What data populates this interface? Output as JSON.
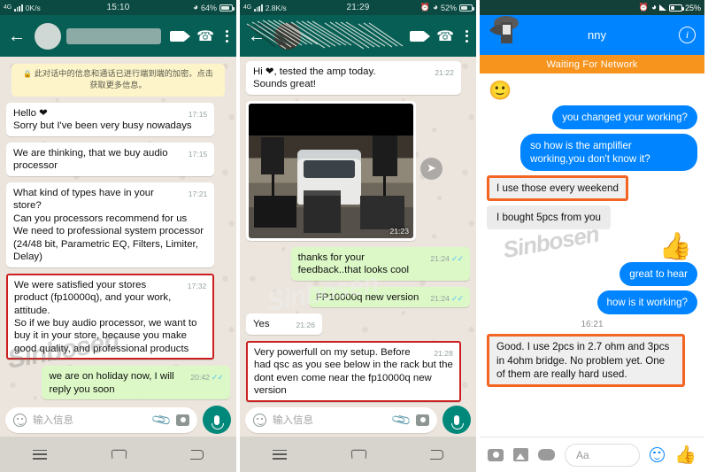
{
  "panel1": {
    "status": {
      "network": "4G",
      "speed": "0K/s",
      "time": "15:10",
      "battery": "64%"
    },
    "header": {
      "back_icon": "arrow-left-icon",
      "contact_name_redacted": "",
      "video_icon": "video-call-icon",
      "call_icon": "phone-call-icon",
      "menu_icon": "overflow-menu-icon"
    },
    "encryption_notice": "此对话中的信息和通话已进行端到端的加密。点击获取更多信息。",
    "messages": [
      {
        "side": "in",
        "text": "Hello ❤\nSorry but I've been very busy nowadays",
        "time": "17:15",
        "highlight": false
      },
      {
        "side": "in",
        "text": "We are thinking, that we buy audio processor",
        "time": "17:15",
        "highlight": false
      },
      {
        "side": "in",
        "text": "What kind of types have in your store?\nCan you processors recommend for us\nWe need to professional system processor (24/48 bit, Parametric EQ, Filters, Limiter, Delay)",
        "time": "17:21",
        "highlight": false
      },
      {
        "side": "in",
        "text": "We were satisfied your stores product (fp10000q), and your work, attitude.\nSo if we buy audio processor, we want to buy it in your store, because you make good quality, and professional products",
        "time": "17:32",
        "highlight": true
      },
      {
        "side": "out",
        "text": "we are on holiday now, I will reply you soon",
        "time": "20:42",
        "highlight": false,
        "ticks": "✓✓"
      }
    ],
    "input": {
      "placeholder": "输入信息",
      "emoji_icon": "emoji-icon",
      "attach_icon": "paperclip-icon",
      "camera_icon": "camera-icon",
      "mic_icon": "microphone-icon"
    },
    "navbar": {
      "menu_icon": "recents-icon",
      "home_icon": "home-icon",
      "back_icon": "back-icon"
    }
  },
  "panel2": {
    "status": {
      "network": "4G",
      "speed": "2.8K/s",
      "time": "21:29",
      "alarm_icon": "alarm-icon",
      "battery": "52%"
    },
    "header": {
      "back_icon": "arrow-left-icon",
      "contact_name_redacted": "",
      "video_icon": "video-call-icon",
      "call_icon": "phone-call-icon",
      "menu_icon": "overflow-menu-icon"
    },
    "messages": [
      {
        "side": "in",
        "type": "text",
        "text": "Hi ❤, tested the amp today.\nSounds great!",
        "time": "21:22",
        "highlight": false
      },
      {
        "side": "in",
        "type": "image",
        "caption": "photo of garage with white van, two PA speakers on stands, subwoofers and an amplifier rack",
        "time": "21:23",
        "forward_icon": "forward-icon"
      },
      {
        "side": "out",
        "type": "text",
        "text": "thanks for your feedback..that looks cool",
        "time": "21:24",
        "ticks": "✓✓",
        "highlight": false
      },
      {
        "side": "out",
        "type": "text",
        "text": "FP10000q new version",
        "time": "21:24",
        "ticks": "✓✓",
        "highlight": false
      },
      {
        "side": "in",
        "type": "text",
        "text": "Yes",
        "time": "21:26",
        "highlight": false
      },
      {
        "side": "in",
        "type": "text",
        "text": "Very powerfull on my setup. Before had qsc as you see below in the rack but the dont even come near the fp10000q new version",
        "time": "21:28",
        "highlight": true
      }
    ],
    "input": {
      "placeholder": "输入信息",
      "emoji_icon": "emoji-icon",
      "attach_icon": "paperclip-icon",
      "camera_icon": "camera-icon",
      "mic_icon": "microphone-icon"
    },
    "navbar": {
      "menu_icon": "recents-icon",
      "home_icon": "home-icon",
      "back_icon": "back-icon"
    }
  },
  "panel3": {
    "status": {
      "alarm_icon": "alarm-icon",
      "wifi_icon": "wifi-icon",
      "signal_icon": "signal-icon",
      "battery": "25%"
    },
    "header": {
      "contact_name": "nny",
      "info_icon": "info-icon",
      "avatar_masked": true
    },
    "banner": "Waiting For Network",
    "messages": [
      {
        "side": "them",
        "type": "emoji",
        "text": "🙂"
      },
      {
        "side": "me",
        "type": "text",
        "text": "you changed your working?"
      },
      {
        "side": "me",
        "type": "text",
        "text": "so how is the amplifier working,you don't know it?"
      },
      {
        "side": "them",
        "type": "text",
        "text": "I use those every weekend",
        "highlight": true
      },
      {
        "side": "them",
        "type": "text",
        "text": "I bought 5pcs from you"
      },
      {
        "side": "me",
        "type": "thumb",
        "text": "👍"
      },
      {
        "side": "me",
        "type": "text",
        "text": "great to hear"
      },
      {
        "side": "me",
        "type": "text",
        "text": "how is it working?"
      },
      {
        "side": "divider",
        "type": "time",
        "text": "16:21"
      },
      {
        "side": "them",
        "type": "text",
        "text": "Good. I use 2pcs in 2.7 ohm and 3pcs in 4ohm bridge. No problem yet. One of them are really hard used.",
        "highlight": true
      }
    ],
    "input": {
      "placeholder": "Aa",
      "camera_icon": "camera-icon",
      "gallery_icon": "gallery-icon",
      "games_icon": "games-icon",
      "emoji_icon": "emoji-icon",
      "like_icon": "thumbs-up-icon"
    }
  },
  "watermark": "Sinbosen",
  "colors": {
    "whatsapp_header": "#075e54",
    "whatsapp_out_bubble": "#dcf8c6",
    "messenger_blue": "#0084ff",
    "banner_orange": "#f7941e",
    "highlight_red": "#cc1f1f",
    "highlight_orange": "#f26522"
  }
}
